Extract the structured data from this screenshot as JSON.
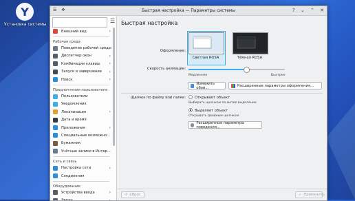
{
  "desktop": {
    "icon_label": "Установка системы"
  },
  "window": {
    "title": "Быстрая настройка — Параметры системы"
  },
  "sidebar": {
    "items": [
      {
        "label": "Внешний вид",
        "icon": "appearance-icon",
        "color": "#d94a3a",
        "arrow": true
      },
      {
        "label": "Рабочая среда",
        "header": true
      },
      {
        "label": "Поведение рабочей среды",
        "icon": "desktop-behavior-icon",
        "color": "#6b7b8c",
        "arrow": true
      },
      {
        "label": "Диспетчер окон",
        "icon": "window-manager-icon",
        "color": "#555d66",
        "arrow": true
      },
      {
        "label": "Комбинации клавиш",
        "icon": "keyboard-icon",
        "color": "#555d66",
        "arrow": true
      },
      {
        "label": "Запуск и завершение",
        "icon": "power-icon",
        "color": "#3f4b57",
        "arrow": true
      },
      {
        "label": "Поиск",
        "icon": "search-icon",
        "color": "#2f8fd8",
        "arrow": true
      },
      {
        "label": "Предпочтения пользователя",
        "header": true
      },
      {
        "label": "Пользователи",
        "icon": "users-icon",
        "color": "#3daee9",
        "arrow": false
      },
      {
        "label": "Уведомления",
        "icon": "notifications-icon",
        "color": "#3daee9",
        "arrow": false
      },
      {
        "label": "Локализация",
        "icon": "locale-icon",
        "color": "#e0a030",
        "arrow": true
      },
      {
        "label": "Дата и время",
        "icon": "clock-icon",
        "color": "#333a40",
        "arrow": false
      },
      {
        "label": "Приложения",
        "icon": "applications-icon",
        "color": "#2f8fd8",
        "arrow": true
      },
      {
        "label": "Специальные возможно...",
        "icon": "accessibility-icon",
        "color": "#2f8fd8",
        "arrow": false
      },
      {
        "label": "Бумажник",
        "icon": "wallet-icon",
        "color": "#7a5a3a",
        "arrow": false
      },
      {
        "label": "Учётные записи в Интер...",
        "icon": "online-accounts-icon",
        "color": "#6b7b8c",
        "arrow": false
      },
      {
        "label": "Сеть и связь",
        "header": true
      },
      {
        "label": "Настройка сети",
        "icon": "network-icon",
        "color": "#2f8fd8",
        "arrow": true
      },
      {
        "label": "Соединения",
        "icon": "connections-icon",
        "color": "#2f8fd8",
        "arrow": false
      },
      {
        "label": "Оборудование",
        "header": true
      },
      {
        "label": "Устройства ввода",
        "icon": "input-devices-icon",
        "color": "#555d66",
        "arrow": true
      },
      {
        "label": "Экран",
        "icon": "display-icon",
        "color": "#555d66",
        "arrow": true
      }
    ]
  },
  "main": {
    "page_title": "Быстрая настройка",
    "theme_label": "Оформление:",
    "themes": [
      {
        "caption": "Светлая ROSA",
        "selected": true
      },
      {
        "caption": "Тёмная ROSA",
        "selected": false
      }
    ],
    "animation_label": "Скорость анимации:",
    "animation_min": "Медленнее",
    "animation_max": "Быстрее",
    "animation_level": 0.6,
    "change_wallpaper_label": "Изменить обои...",
    "advanced_appearance_label": "Расширенные параметры оформления...",
    "click_label": "Щелчок по файлу или папке:",
    "open_option": "Открывает объект",
    "open_hint": "Выбирать щелчком по метке выделения",
    "select_option": "Выделяет объект",
    "select_hint": "Открывать двойным щелчком",
    "advanced_behavior_label": "Расширенные параметры поведения..."
  },
  "footer": {
    "reset_label": "Сброс",
    "apply_label": "Применить"
  }
}
